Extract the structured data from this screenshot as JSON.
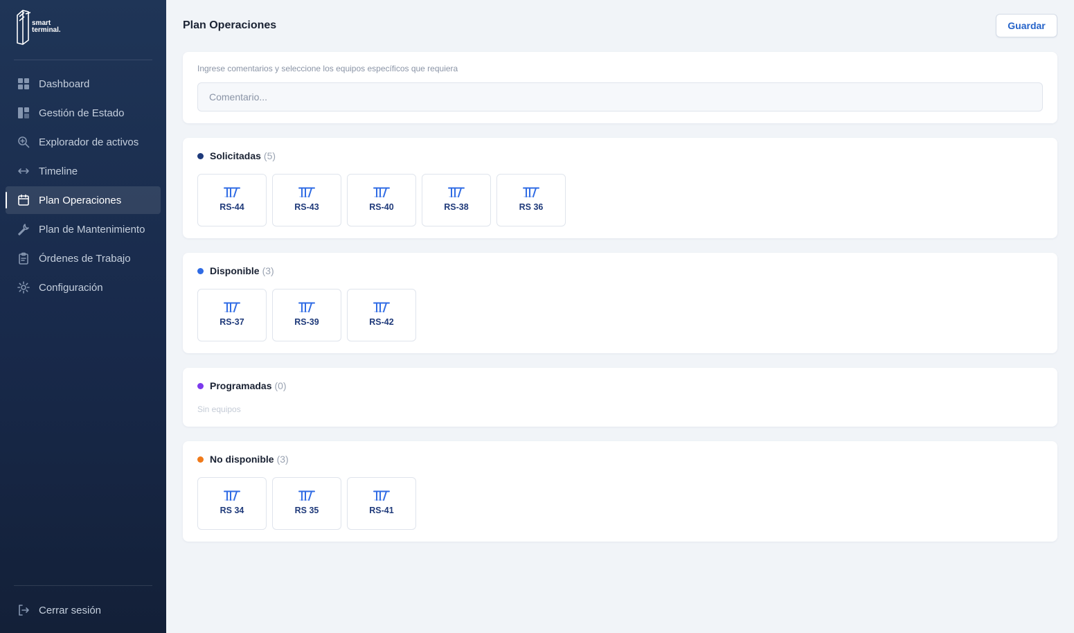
{
  "brand": {
    "line1": "smart",
    "line2": "terminal."
  },
  "sidebar": {
    "items": [
      {
        "label": "Dashboard",
        "icon": "grid-icon"
      },
      {
        "label": "Gestión de Estado",
        "icon": "layout-icon"
      },
      {
        "label": "Explorador de activos",
        "icon": "search-plus-icon"
      },
      {
        "label": "Timeline",
        "icon": "arrows-horizontal-icon"
      },
      {
        "label": "Plan Operaciones",
        "icon": "calendar-icon",
        "active": true
      },
      {
        "label": "Plan de Mantenimiento",
        "icon": "wrench-icon"
      },
      {
        "label": "Órdenes de Trabajo",
        "icon": "clipboard-icon"
      },
      {
        "label": "Configuración",
        "icon": "gear-icon"
      }
    ],
    "logout": {
      "label": "Cerrar sesión",
      "icon": "logout-icon"
    }
  },
  "header": {
    "title": "Plan Operaciones",
    "save_label": "Guardar"
  },
  "comment": {
    "hint": "Ingrese comentarios y seleccione los equipos específicos que requiera",
    "placeholder": "Comentario...",
    "value": ""
  },
  "sections": [
    {
      "title": "Solicitadas",
      "count": "(5)",
      "color": "#1e3a7b",
      "items": [
        "RS-44",
        "RS-43",
        "RS-40",
        "RS-38",
        "RS 36"
      ]
    },
    {
      "title": "Disponible",
      "count": "(3)",
      "color": "#2f6be4",
      "items": [
        "RS-37",
        "RS-39",
        "RS-42"
      ]
    },
    {
      "title": "Programadas",
      "count": "(0)",
      "color": "#7c3aed",
      "items": [],
      "empty": "Sin equipos"
    },
    {
      "title": "No disponible",
      "count": "(3)",
      "color": "#f07a1a",
      "items": [
        "RS 34",
        "RS 35",
        "RS-41"
      ]
    }
  ],
  "colors": {
    "accent": "#2563c9",
    "tile_icon": "#2f6be4",
    "tile_label": "#1f3a7a"
  },
  "tile_icon": "crane-icon"
}
